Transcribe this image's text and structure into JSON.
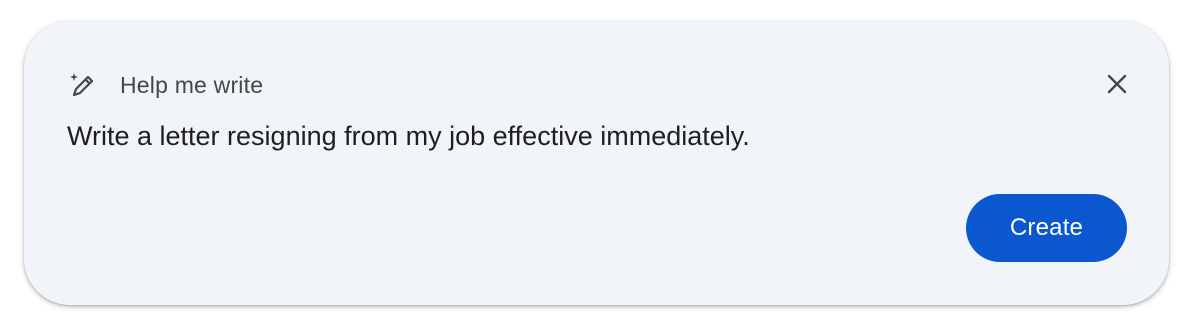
{
  "dialog": {
    "title": "Help me write",
    "title_icon": "magic-pen-icon",
    "close_icon": "close-icon",
    "prompt_text": "Write a letter resigning from my job effective immediately.",
    "create_label": "Create"
  },
  "colors": {
    "card_background": "#f1f4f9",
    "primary_button": "#0b57d0",
    "primary_button_text": "#ffffff",
    "title_text": "#444746",
    "body_text": "#1f1f1f"
  }
}
